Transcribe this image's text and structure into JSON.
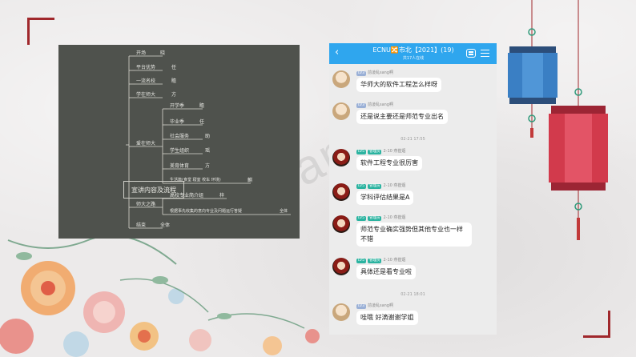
{
  "watermark": "Sample",
  "mindmap": {
    "root": "宣讲内容及流程",
    "branches": [
      {
        "label": "开场",
        "sub": "晓"
      },
      {
        "label": "平台优势",
        "sub": "任"
      },
      {
        "label": "一流名校",
        "sub": "瞻"
      },
      {
        "label": "学在师大",
        "sub": "方"
      },
      {
        "label": "爱在师大",
        "children": [
          {
            "label": "开学季",
            "sub": "瞻"
          },
          {
            "label": "毕业季",
            "sub": "任"
          },
          {
            "label": "社会服务",
            "sub": "助"
          },
          {
            "label": "学生组织",
            "sub": "瑶"
          },
          {
            "label": "美育体育",
            "sub": "方"
          },
          {
            "label": "生活篇(食堂 寝室 校车 环境)",
            "sub": "麒"
          }
        ]
      },
      {
        "label": "师大之路",
        "children": [
          {
            "label": "高校专业简介组",
            "sub": "梓"
          },
          {
            "label": "根据事先收集的意向专业及问题运行答疑",
            "sub": "全体"
          }
        ]
      },
      {
        "label": "结束",
        "sub": "全体"
      }
    ]
  },
  "chat": {
    "back_icon": "‹",
    "title": "ECNU🔀市北【2021】(19)",
    "subtitle": "共17人在线",
    "messages": [
      {
        "type": "msg",
        "avatar": "a",
        "badge": "LV3",
        "badge_color": "gray",
        "name": "",
        "sender": "前凌乱sang啊",
        "time": "",
        "text": "华师大的软件工程怎么样呀"
      },
      {
        "type": "msg",
        "avatar": "a",
        "badge": "LV3",
        "badge_color": "gray",
        "name": "",
        "sender": "前凌乱sang啊",
        "time": "",
        "text": "还是说主要还是师范专业出名"
      },
      {
        "type": "time",
        "text": "02-21 17:55"
      },
      {
        "type": "msg",
        "avatar": "b",
        "badge": "LV5",
        "badge_color": "green",
        "name": "管理员",
        "sender": "燕崔烟",
        "time": "2-10",
        "text": "软件工程专业很厉害"
      },
      {
        "type": "msg",
        "avatar": "b",
        "badge": "LV5",
        "badge_color": "green",
        "name": "管理员",
        "sender": "燕崔烟",
        "time": "2-10",
        "text": "学科评估结果是A"
      },
      {
        "type": "msg",
        "avatar": "b",
        "badge": "LV5",
        "badge_color": "green",
        "name": "管理员",
        "sender": "燕崔烟",
        "time": "2-10",
        "text": "师范专业确实强势但其他专业也一样不错"
      },
      {
        "type": "msg",
        "avatar": "b",
        "badge": "LV5",
        "badge_color": "green",
        "name": "管理员",
        "sender": "燕崔烟",
        "time": "2-10",
        "text": "具体还是看专业啦"
      },
      {
        "type": "time",
        "text": "02-21 18:01"
      },
      {
        "type": "msg",
        "avatar": "a",
        "badge": "LV3",
        "badge_color": "gray",
        "name": "",
        "sender": "前凌乱sang啊",
        "time": "",
        "text": "哇哦 好滴谢谢学姐"
      }
    ]
  },
  "colors": {
    "accent_red": "#a0282c",
    "chat_header": "#2fa6ee",
    "mindmap_bg": "#4f524d",
    "lantern_blue": "#3a7fc4",
    "lantern_red": "#d23a4c"
  }
}
